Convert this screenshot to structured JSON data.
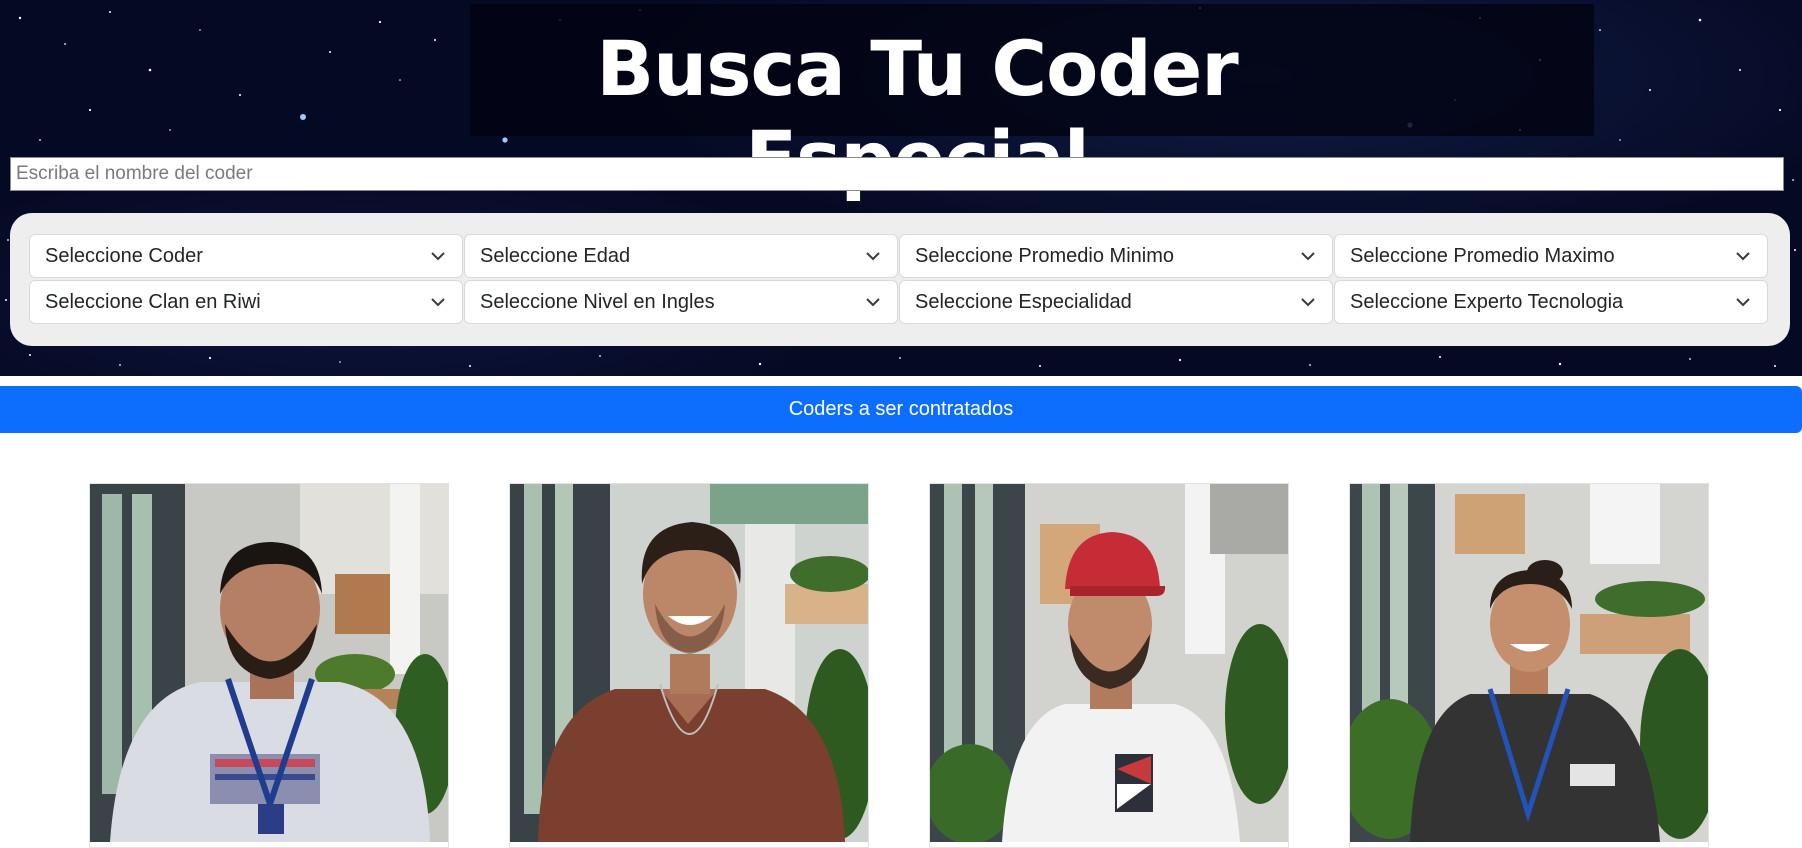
{
  "header": {
    "title": "Busca Tu Coder Especial"
  },
  "search": {
    "placeholder": "Escriba el nombre del coder",
    "value": ""
  },
  "filters": [
    {
      "label": "Seleccione Coder"
    },
    {
      "label": "Seleccione Edad"
    },
    {
      "label": "Seleccione Promedio Minimo"
    },
    {
      "label": "Seleccione Promedio Maximo"
    },
    {
      "label": "Seleccione Clan en Riwi"
    },
    {
      "label": "Seleccione Nivel en Ingles"
    },
    {
      "label": "Seleccione Especialidad"
    },
    {
      "label": "Seleccione Experto Tecnologia"
    }
  ],
  "banner": {
    "label": "Coders a ser contratados"
  },
  "cards": [
    {
      "photo": "coder-photo",
      "shirt_color": "#d9dde3",
      "hair": "short",
      "lanyard": true
    },
    {
      "photo": "coder-photo",
      "shirt_color": "#7a3f2e",
      "hair": "short",
      "lanyard": false
    },
    {
      "photo": "coder-photo",
      "shirt_color": "#f2f2f2",
      "hair": "cap",
      "lanyard": false
    },
    {
      "photo": "coder-photo",
      "shirt_color": "#333333",
      "hair": "bun",
      "lanyard": true
    }
  ],
  "colors": {
    "primary": "#0d6efd",
    "hero_bg": "#050a24",
    "panel_bg": "#eeeeee"
  }
}
